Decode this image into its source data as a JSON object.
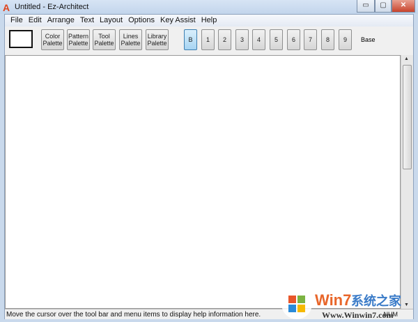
{
  "window": {
    "title": "Untitled - Ez-Architect",
    "minimize": "▭",
    "maximize": "▢",
    "close": "✕"
  },
  "menu": [
    "File",
    "Edit",
    "Arrange",
    "Text",
    "Layout",
    "Options",
    "Key Assist",
    "Help"
  ],
  "palettes": [
    {
      "l1": "Color",
      "l2": "Palette"
    },
    {
      "l1": "Pattern",
      "l2": "Palette"
    },
    {
      "l1": "Tool",
      "l2": "Palette"
    },
    {
      "l1": "Lines",
      "l2": "Palette"
    },
    {
      "l1": "Library",
      "l2": "Palette"
    }
  ],
  "layers": [
    "B",
    "1",
    "2",
    "3",
    "4",
    "5",
    "6",
    "7",
    "8",
    "9"
  ],
  "active_layer": "B",
  "layer_name": "Base",
  "status": {
    "text": "Move the cursor over the tool bar and menu items to display help information here.",
    "num": "NUM"
  },
  "watermark": {
    "brand": "Win7系统之家",
    "url": "Www.Winwin7.com"
  }
}
